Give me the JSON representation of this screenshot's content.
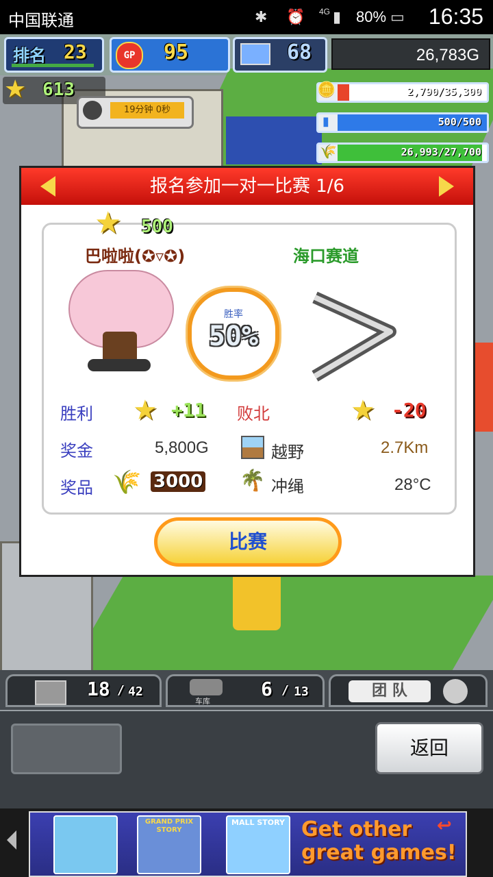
{
  "status_bar": {
    "carrier": "中国联通",
    "network": "4G",
    "battery": "80%",
    "time": "16:35"
  },
  "hud": {
    "rank_label": "排名",
    "rank_value": "23",
    "gp_label": "GP",
    "gp_value": "95",
    "computer_value": "68",
    "money": "26,783G",
    "stars": "613",
    "timer_text": "19分钟 0秒",
    "bars": [
      {
        "text": "2,790/35,300",
        "color": "#e8442a",
        "fraction": 0.08
      },
      {
        "text": "500/500",
        "color": "#2e7ae8",
        "fraction": 1.0
      },
      {
        "text": "26,993/27,700",
        "color": "#3fbf3a",
        "fraction": 0.97
      }
    ]
  },
  "dialog": {
    "title": "报名参加一对一比赛 1/6",
    "opponent_stars": "500",
    "opponent_name": "巴啦啦(✪▿✪)",
    "course_name": "海口赛道",
    "winrate_label": "胜率",
    "winrate_value": "50%",
    "win_label": "胜利",
    "win_value": "+11",
    "lose_label": "败北",
    "lose_value": "-20",
    "prize_money_label": "奖金",
    "prize_money_value": "5,800G",
    "terrain_label": "越野",
    "distance": "2.7Km",
    "item_label": "奖品",
    "item_value": "3000",
    "location": "冲绳",
    "temperature": "28°C",
    "start_button": "比赛"
  },
  "bottom_tabs": [
    {
      "value": "18",
      "max": "42"
    },
    {
      "label": "车库",
      "value": "6",
      "max": "13"
    },
    {
      "label": "团 队"
    }
  ],
  "back_button": "返回",
  "ad": {
    "games": [
      "GRAND PRIX STORY",
      "MALL STORY"
    ],
    "tagline_1": "Get other",
    "tagline_2": "great games!"
  },
  "colors": {
    "title_red": "#e0261c",
    "accent_orange": "#ff9a1a",
    "hud_blue": "#1f3b73"
  }
}
